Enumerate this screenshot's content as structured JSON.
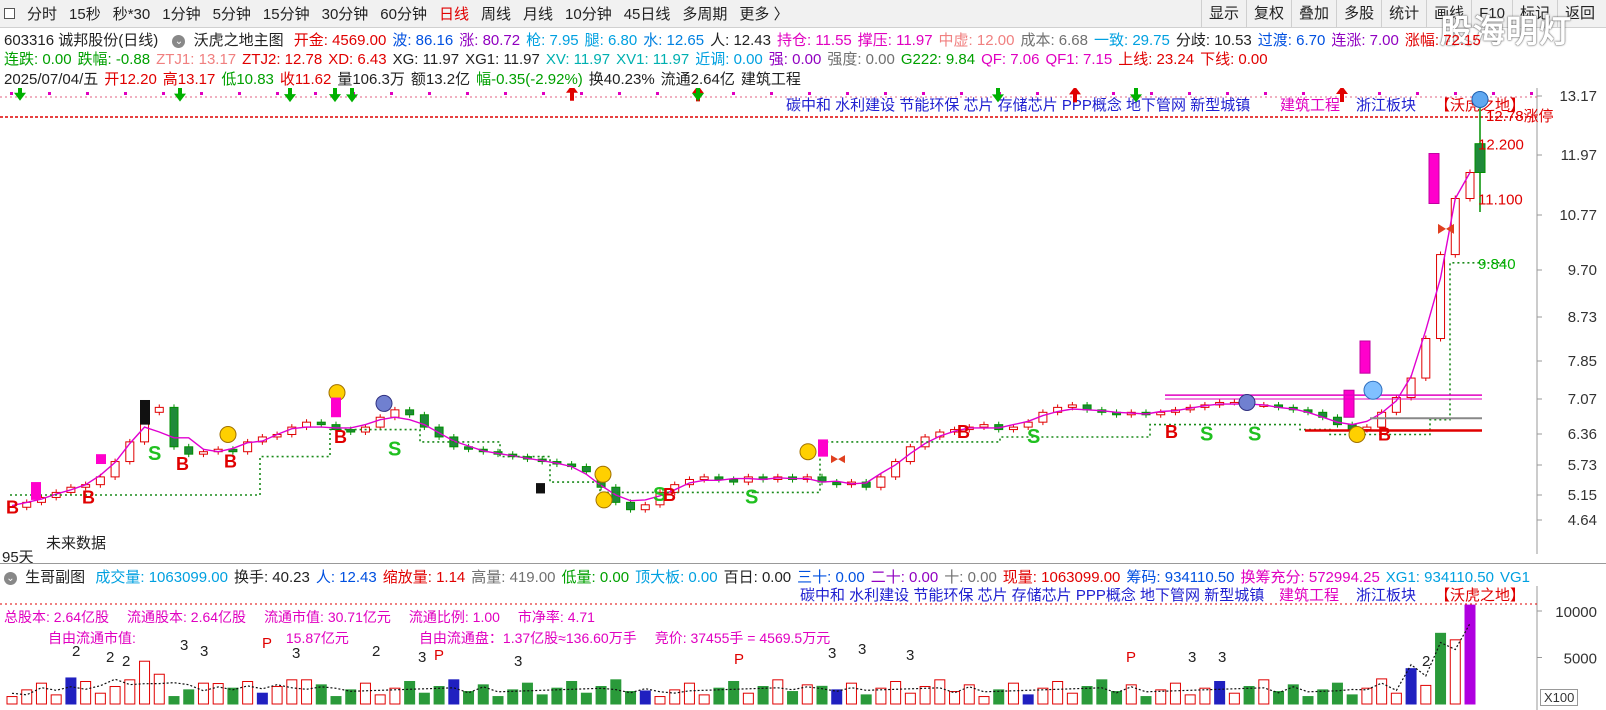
{
  "watermark": "股海明灯",
  "toolbar": {
    "periods": [
      {
        "label": "分时",
        "active": false
      },
      {
        "label": "15秒",
        "active": false
      },
      {
        "label": "秒*30",
        "active": false
      },
      {
        "label": "1分钟",
        "active": false
      },
      {
        "label": "5分钟",
        "active": false
      },
      {
        "label": "15分钟",
        "active": false
      },
      {
        "label": "30分钟",
        "active": false
      },
      {
        "label": "60分钟",
        "active": false
      },
      {
        "label": "日线",
        "active": true
      },
      {
        "label": "周线",
        "active": false
      },
      {
        "label": "月线",
        "active": false
      },
      {
        "label": "10分钟",
        "active": false
      },
      {
        "label": "45日线",
        "active": false
      },
      {
        "label": "多周期",
        "active": false
      },
      {
        "label": "更多 〉",
        "active": false
      }
    ],
    "actions": [
      "显示",
      "复权",
      "叠加",
      "多股",
      "统计",
      "画线",
      "F10",
      "标记",
      "返回"
    ]
  },
  "info": {
    "stock_title": "603316 诚邦股份(日线)",
    "indicator_name": "沃虎之地主图",
    "row1": [
      {
        "label": "开金: ",
        "value": "4569.00",
        "color": "#e00000"
      },
      {
        "label": "波: ",
        "value": "86.16",
        "color": "#0050e0"
      },
      {
        "label": "涨: ",
        "value": "80.72",
        "color": "#9000c0"
      },
      {
        "label": "枪: ",
        "value": "7.95",
        "color": "#00a0e0"
      },
      {
        "label": "腿: ",
        "value": "6.80",
        "color": "#00a0e0"
      },
      {
        "label": "水: ",
        "value": "12.65",
        "color": "#0080e0"
      },
      {
        "label": "人: ",
        "value": "12.43",
        "color": "#222222"
      },
      {
        "label": "持仓: ",
        "value": "11.55",
        "color": "#e000c0"
      },
      {
        "label": "撑压: ",
        "value": "11.97",
        "color": "#e000c0"
      },
      {
        "label": "中虚: ",
        "value": "12.00",
        "color": "#f08080"
      },
      {
        "label": "成本: ",
        "value": "6.68",
        "color": "#707070"
      },
      {
        "label": "一致: ",
        "value": "29.75",
        "color": "#00a0e0"
      },
      {
        "label": "分歧: ",
        "value": "10.53",
        "color": "#222222"
      },
      {
        "label": "过渡: ",
        "value": "6.70",
        "color": "#0050e0"
      },
      {
        "label": "连涨: ",
        "value": "7.00",
        "color": "#9000c0"
      },
      {
        "label": "涨幅: ",
        "value": "72.15",
        "color": "#e00000"
      }
    ],
    "row2": [
      {
        "label": "连跌: ",
        "value": "0.00",
        "color": "#00a000"
      },
      {
        "label": "跌幅: ",
        "value": "-0.88",
        "color": "#00a000"
      },
      {
        "label": "ZTJ1: ",
        "value": "13.17",
        "color": "#f08080"
      },
      {
        "label": "ZTJ2: ",
        "value": "12.78",
        "color": "#e00000"
      },
      {
        "label": "XD: ",
        "value": "6.43",
        "color": "#e00000"
      },
      {
        "label": "XG: ",
        "value": "11.97",
        "color": "#222222"
      },
      {
        "label": "XG1: ",
        "value": "11.97",
        "color": "#222222"
      },
      {
        "label": "XV: ",
        "value": "11.97",
        "color": "#00b0b0"
      },
      {
        "label": "XV1: ",
        "value": "11.97",
        "color": "#00b0b0"
      },
      {
        "label": "近调: ",
        "value": "0.00",
        "color": "#00a0e0"
      },
      {
        "label": "强: ",
        "value": "0.00",
        "color": "#9000c0"
      },
      {
        "label": "强度: ",
        "value": "0.00",
        "color": "#707070"
      },
      {
        "label": "G222: ",
        "value": "9.84",
        "color": "#00a000"
      },
      {
        "label": "QF: ",
        "value": "7.06",
        "color": "#e000c0"
      },
      {
        "label": "QF1: ",
        "value": "7.15",
        "color": "#e000c0"
      },
      {
        "label": "上线: ",
        "value": "23.24",
        "color": "#e00000"
      },
      {
        "label": "下线: ",
        "value": "0.00",
        "color": "#e00000"
      }
    ],
    "row3": [
      {
        "text": "2025/07/04/五",
        "color": "#222222"
      },
      {
        "text": "开12.20",
        "color": "#e00000"
      },
      {
        "text": "高13.17",
        "color": "#e00000"
      },
      {
        "text": "低10.83",
        "color": "#00a000"
      },
      {
        "text": "收11.62",
        "color": "#e00000"
      },
      {
        "text": "量106.3万",
        "color": "#222222"
      },
      {
        "text": "额13.2亿",
        "color": "#222222"
      },
      {
        "text": "幅-0.35(-2.92%)",
        "color": "#00a000"
      },
      {
        "text": "换40.23%",
        "color": "#222222"
      },
      {
        "text": "流通2.64亿",
        "color": "#222222"
      },
      {
        "text": "建筑工程",
        "color": "#222222"
      }
    ]
  },
  "main": {
    "concepts": [
      {
        "text": "碳中和 水利建设 节能环保 芯片 存储芯片 PPP概念 地下管网 新型城镇",
        "color": "#2020d0"
      },
      {
        "text": "建筑工程",
        "color": "#e000c0"
      },
      {
        "text": "浙江板块",
        "color": "#2020d0"
      },
      {
        "text": "【沃虎之地】",
        "color": "#e00000"
      }
    ],
    "price_ticks": [
      "13.17",
      "11.97",
      "10.77",
      "9.70",
      "8.73",
      "7.85",
      "7.07",
      "6.36",
      "5.73",
      "5.15",
      "4.64"
    ],
    "price_labels": [
      {
        "text": "12.78涨停",
        "color": "#e00000"
      },
      {
        "text": "12.200",
        "color": "#e00000"
      },
      {
        "text": "11.100",
        "color": "#e00000"
      },
      {
        "text": "9.840",
        "color": "#00b000"
      }
    ],
    "future_label": "未来数据",
    "days_label": "95天"
  },
  "sub": {
    "name": "生哥副图",
    "items": [
      {
        "label": "成交量: ",
        "value": "1063099.00",
        "color": "#00a0e0"
      },
      {
        "label": "换手: ",
        "value": "40.23",
        "color": "#222222"
      },
      {
        "label": "人: ",
        "value": "12.43",
        "color": "#0050e0"
      },
      {
        "label": "缩放量: ",
        "value": "1.14",
        "color": "#e00000"
      },
      {
        "label": "高量: ",
        "value": "419.00",
        "color": "#707070"
      },
      {
        "label": "低量: ",
        "value": "0.00",
        "color": "#00a000"
      },
      {
        "label": "顶大板: ",
        "value": "0.00",
        "color": "#00a0e0"
      },
      {
        "label": "百日: ",
        "value": "0.00",
        "color": "#222222"
      },
      {
        "label": "三十: ",
        "value": "0.00",
        "color": "#0050e0"
      },
      {
        "label": "二十: ",
        "value": "0.00",
        "color": "#9000c0"
      },
      {
        "label": "十: ",
        "value": "0.00",
        "color": "#707070"
      },
      {
        "label": "现量: ",
        "value": "1063099.00",
        "color": "#e00000"
      },
      {
        "label": "筹码: ",
        "value": "934110.50",
        "color": "#0050e0"
      },
      {
        "label": "换筹充分: ",
        "value": "572994.25",
        "color": "#e000c0"
      },
      {
        "label": "XG1: ",
        "value": "934110.50",
        "color": "#00a0e0"
      },
      {
        "label": "VG1",
        "value": "",
        "color": "#00a0e0"
      }
    ],
    "vol_ticks": [
      "10000",
      "5000"
    ],
    "scale_badge": "X100",
    "stats1": [
      "总股本:  2.64亿股",
      "流通股本:  2.64亿股",
      "流通市值:  30.71亿元",
      "流通比例:  1.00",
      "市净率:  4.71"
    ],
    "stats2": [
      "自由流通市值:",
      "15.87亿元",
      "自由流通盘：1.37亿股≈136.60万手",
      "竞价:  37455手 = 4569.5万元"
    ]
  },
  "chart_data": [
    {
      "type": "candlestick",
      "title": "603316 诚邦股份(日线)",
      "y_ticks": [
        13.17,
        11.97,
        10.77,
        9.7,
        8.73,
        7.85,
        7.07,
        6.36,
        5.73,
        5.15,
        4.64
      ],
      "ylim": [
        4.45,
        13.3
      ],
      "last_bar": {
        "date": "2025/07/04",
        "open": 12.2,
        "high": 13.17,
        "low": 10.83,
        "close": 11.62
      },
      "markers": [
        {
          "type": "S",
          "label": "S"
        },
        {
          "type": "B",
          "label": "B"
        },
        {
          "type": "P",
          "label": "P"
        }
      ]
    },
    {
      "type": "bar",
      "title": "生哥副图",
      "y_ticks": [
        10000,
        5000
      ],
      "ylim": [
        0,
        11000
      ],
      "annotations": [
        "2",
        "2",
        "2",
        "3",
        "3",
        "P",
        "3",
        "2",
        "3",
        "P",
        "3",
        "P",
        "3",
        "3",
        "3",
        "P",
        "3",
        "3",
        "2"
      ]
    }
  ]
}
